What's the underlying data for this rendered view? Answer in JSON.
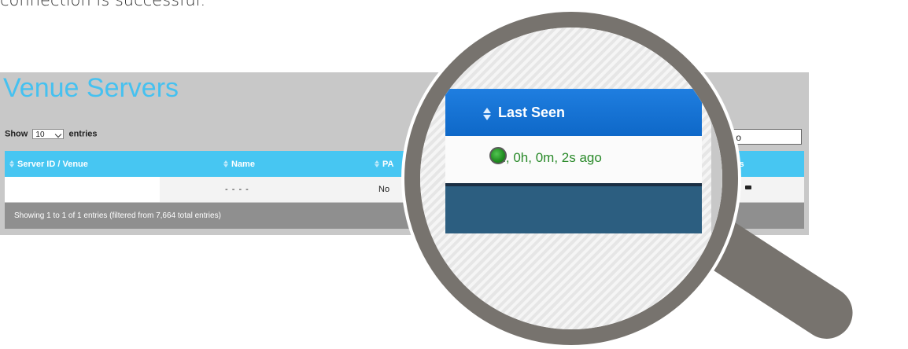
{
  "intro_text": "connection is successful.",
  "page": {
    "title": "Venue Servers",
    "length_prefix": "Show",
    "length_value": "10",
    "length_suffix": "entries",
    "search_value": "stro"
  },
  "table": {
    "columns": [
      {
        "label": "Server ID / Venue"
      },
      {
        "label": "Name"
      },
      {
        "label": "PA"
      },
      {
        "label": "ons"
      }
    ],
    "rows": [
      {
        "server_id": "",
        "name": "- - - -",
        "pa": "No"
      }
    ],
    "info": "Showing 1 to 1 of 1 entries (filtered from 7,664 total entries)"
  },
  "magnified": {
    "column_label": "Last Seen",
    "value": "0d, 0h, 0m, 2s ago",
    "status_color": "#1f8c1f",
    "value_color": "#2a8a2a"
  },
  "colors": {
    "accent": "#47c6f2",
    "title": "#45c1f0",
    "magnifier": "#77736e",
    "zoom_header": "#0e68c8"
  }
}
